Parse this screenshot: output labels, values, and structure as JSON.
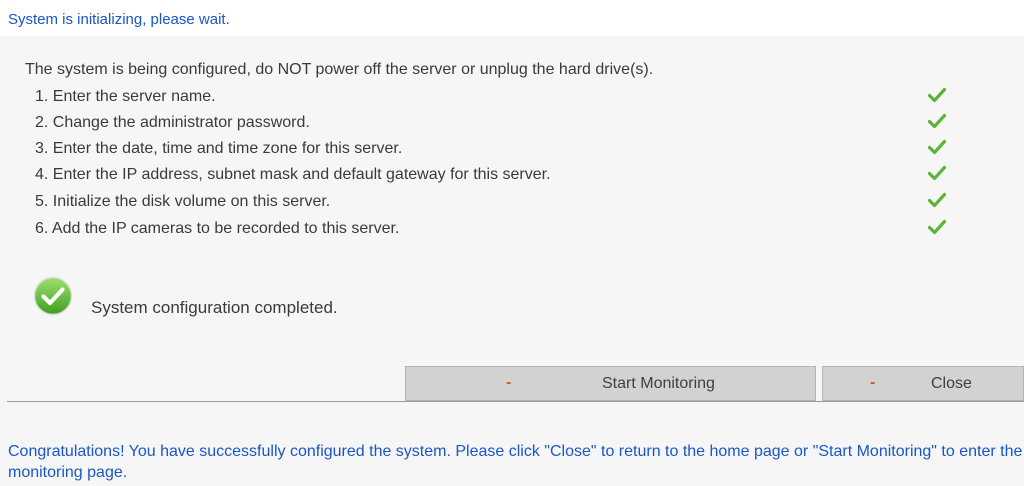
{
  "header": {
    "title": "System is initializing, please wait."
  },
  "intro": "The system is being configured, do NOT power off the server or unplug the hard drive(s).",
  "steps": [
    {
      "label": "1. Enter the server name.",
      "status": "done"
    },
    {
      "label": "2. Change the administrator password.",
      "status": "done"
    },
    {
      "label": "3. Enter the date, time and time zone for this server.",
      "status": "done"
    },
    {
      "label": "4. Enter the IP address, subnet mask and default gateway for this server.",
      "status": "done"
    },
    {
      "label": "5. Initialize the disk volume on this server.",
      "status": "done"
    },
    {
      "label": "6. Add the IP cameras to be recorded to this server.",
      "status": "done"
    }
  ],
  "completion": {
    "icon": "check-circle-icon",
    "text": "System configuration completed."
  },
  "buttons": {
    "start_monitoring": {
      "marker": "-",
      "label": "Start Monitoring"
    },
    "close": {
      "marker": "-",
      "label": "Close"
    }
  },
  "message": "Congratulations! You have successfully configured the system. Please click \"Close\" to return to the home page or \"Start Monitoring\" to enter the monitoring page.",
  "colors": {
    "link_text": "#1a56c8",
    "check_green": "#5fb336",
    "button_marker": "#e0532f",
    "panel_background": "#f6f6f6"
  }
}
